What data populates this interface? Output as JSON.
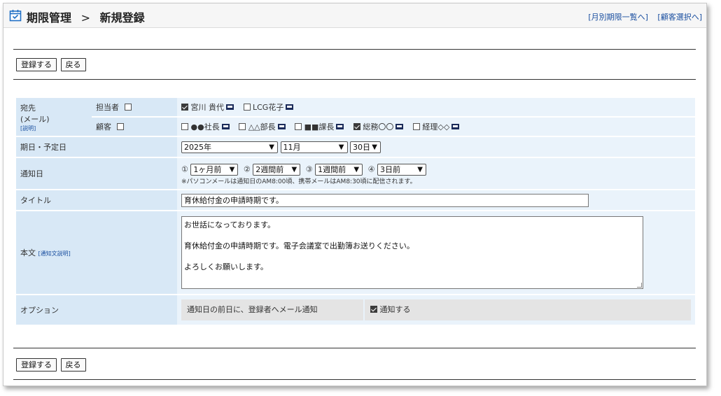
{
  "header": {
    "title": "期限管理",
    "separator": ">",
    "subtitle": "新規登録",
    "link_monthly": "[月別期限一覧へ]",
    "link_customer": "[顧客選択へ]"
  },
  "buttons": {
    "register": "登録する",
    "back": "戻る"
  },
  "form": {
    "destination": {
      "label": "宛先",
      "label_sub": "(メール)",
      "help": "[説明]",
      "staff_label": "担当者",
      "customer_label": "顧客",
      "staff": [
        {
          "name": "宮川 貴代",
          "checked": true
        },
        {
          "name": "LCG花子",
          "checked": false
        }
      ],
      "customers": [
        {
          "name": "●●社長",
          "checked": false
        },
        {
          "name": "△△部長",
          "checked": false
        },
        {
          "name": "■■課長",
          "checked": false
        },
        {
          "name": "総務〇〇",
          "checked": true
        },
        {
          "name": "経理◇◇",
          "checked": false
        }
      ]
    },
    "date": {
      "label": "期日・予定日",
      "year": "2025年",
      "month": "11月",
      "day": "30日"
    },
    "notify": {
      "label": "通知日",
      "n1": "①",
      "v1": "1ヶ月前",
      "n2": "②",
      "v2": "2週間前",
      "n3": "③",
      "v3": "1週間前",
      "n4": "④",
      "v4": "3日前",
      "note": "※パソコンメールは通知日のAM8:00頃、携帯メールはAM8:30頃に配信されます。"
    },
    "title_field": {
      "label": "タイトル",
      "value": "育休給付金の申請時期です。"
    },
    "body": {
      "label": "本文",
      "help": "[通知文説明]",
      "line1": "お世話になっております。",
      "line2": "育休給付金の申請時期です。電子会議室で出勤簿お送りください。",
      "line3": "よろしくお願いします。"
    },
    "option": {
      "label": "オプション",
      "desc": "通知日の前日に、登録者へメール通知",
      "check_label": "通知する",
      "checked": true
    }
  }
}
